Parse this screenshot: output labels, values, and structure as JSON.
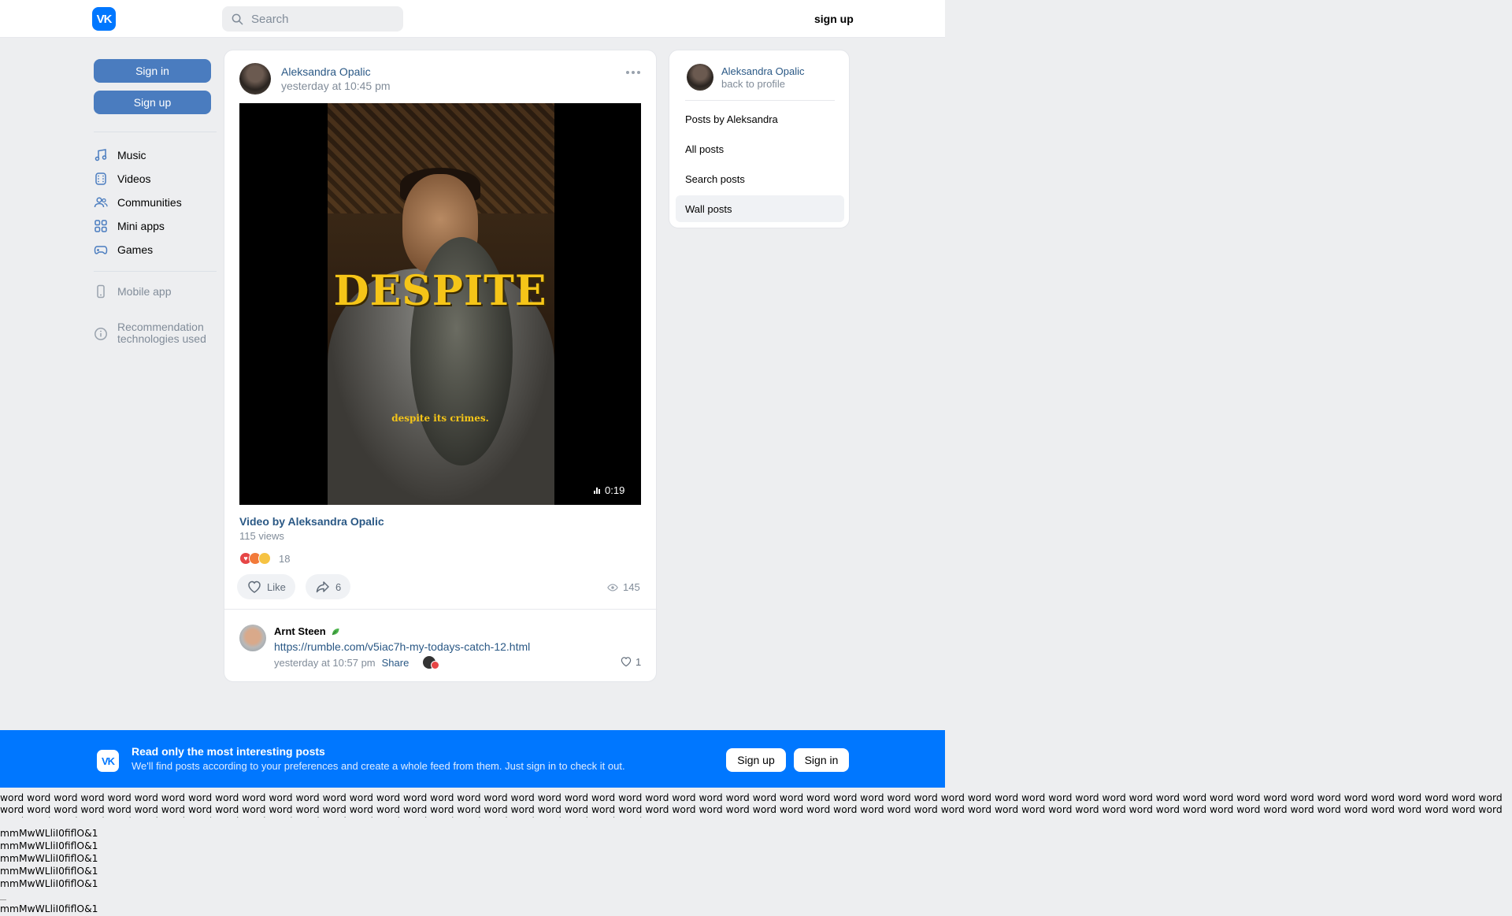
{
  "header": {
    "logo": "VK",
    "search_placeholder": "Search",
    "signup_label": "sign up"
  },
  "sidebar": {
    "signin_label": "Sign in",
    "signup_label": "Sign up",
    "items": [
      {
        "label": "Music",
        "icon": "music-note-icon"
      },
      {
        "label": "Videos",
        "icon": "video-film-icon"
      },
      {
        "label": "Communities",
        "icon": "users-icon"
      },
      {
        "label": "Mini apps",
        "icon": "grid-icon"
      },
      {
        "label": "Games",
        "icon": "gamepad-icon"
      }
    ],
    "mobile_app_label": "Mobile app",
    "recommendation_label": "Recommendation technologies used"
  },
  "post": {
    "author": "Aleksandra Opalic",
    "time": "yesterday at 10:45 pm",
    "video": {
      "overlay_text": "DESPITE",
      "subtitle": "despite its crimes.",
      "duration": "0:19"
    },
    "video_title": "Video by Aleksandra Opalic",
    "video_views": "115 views",
    "reactions_count": "18",
    "like_label": "Like",
    "share_count": "6",
    "views_count": "145"
  },
  "comment": {
    "author": "Arnt Steen",
    "link": "https://rumble.com/v5iac7h-my-todays-catch-12.html",
    "time": "yesterday at 10:57 pm",
    "share_label": "Share",
    "likes": "1"
  },
  "right_panel": {
    "name": "Aleksandra Opalic",
    "back_label": "back to profile",
    "items": [
      {
        "label": "Posts by Aleksandra",
        "active": false
      },
      {
        "label": "All posts",
        "active": false
      },
      {
        "label": "Search posts",
        "active": false
      },
      {
        "label": "Wall posts",
        "active": true
      }
    ]
  },
  "banner": {
    "title": "Read only the most interesting posts",
    "text": "We'll find posts according to your preferences and create a whole feed from them. Just sign in to check it out.",
    "signup_label": "Sign up",
    "signin_label": "Sign in"
  },
  "debug": {
    "words": "word word word word word word word word word word word word word word word word word word word word word word word word word word word word word word word word word word word word word word word word word word word word word word word word word word word word word word word word word word word word word word word word word word word word word word word word word word word word word word word word word word word word word word word word word word word word word word word word word word word word word word word word word word word word word word word word word word word word word word word word word word word word word word word word word word word word word word word word",
    "m_line": "mmMwWLliI0fiflO&1"
  },
  "colors": {
    "brand": "#0077ff",
    "button": "#4a7cbf",
    "link": "#2a5885",
    "muted": "#818c99",
    "background": "#edeef0"
  }
}
